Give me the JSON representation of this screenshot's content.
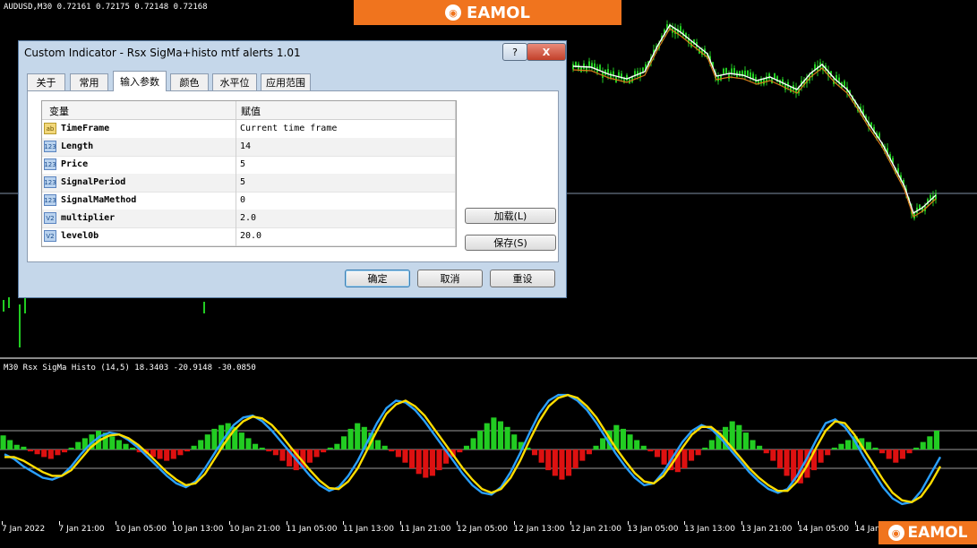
{
  "main_chart": {
    "info": "AUDUSD,M30  0.72161 0.72175 0.72148 0.72168"
  },
  "sub_chart": {
    "info": "M30  Rsx SigMa Histo (14,5) 18.3403 -20.9148 -30.0850"
  },
  "branding": {
    "text": "EAMOL",
    "icon": "eamol-logo-icon"
  },
  "time_axis": [
    "7 Jan 2022",
    "7 Jan 21:00",
    "10 Jan 05:00",
    "10 Jan 13:00",
    "10 Jan 21:00",
    "11 Jan 05:00",
    "11 Jan 13:00",
    "11 Jan 21:00",
    "12 Jan 05:00",
    "12 Jan 13:00",
    "12 Jan 21:00",
    "13 Jan 05:00",
    "13 Jan 13:00",
    "13 Jan 21:00",
    "14 Jan 05:00",
    "14 Jan 13:00"
  ],
  "colors": {
    "up_bar": "#22cc22",
    "down_bar": "#dd1111",
    "signal_line": "#ffdd00",
    "rsx_line": "#2aa0ff",
    "ma_line": "#d97a1a",
    "price_line": "#ffffff",
    "brand": "#f0741e"
  },
  "dialog": {
    "title": "Custom Indicator - Rsx SigMa+histo mtf alerts 1.01",
    "help_label": "?",
    "close_label": "X",
    "tabs": [
      {
        "label": "关于",
        "active": false
      },
      {
        "label": "常用",
        "active": false
      },
      {
        "label": "输入参数",
        "active": true
      },
      {
        "label": "颜色",
        "active": false
      },
      {
        "label": "水平位",
        "active": false
      },
      {
        "label": "应用范围",
        "active": false
      }
    ],
    "grid": {
      "columns": [
        "变量",
        "赋值"
      ],
      "rows": [
        {
          "icon": "ab",
          "name": "TimeFrame",
          "value": "Current time frame"
        },
        {
          "icon": "123",
          "name": "Length",
          "value": "14"
        },
        {
          "icon": "123",
          "name": "Price",
          "value": "5"
        },
        {
          "icon": "123",
          "name": "SignalPeriod",
          "value": "5"
        },
        {
          "icon": "123",
          "name": "SignalMaMethod",
          "value": "0"
        },
        {
          "icon": "V2",
          "name": "multiplier",
          "value": "2.0"
        },
        {
          "icon": "V2",
          "name": "level0b",
          "value": "20.0"
        }
      ]
    },
    "load_label": "加载(L)",
    "save_label": "保存(S)",
    "ok_label": "确定",
    "cancel_label": "取消",
    "reset_label": "重设"
  },
  "chart_data": {
    "type": "bar",
    "title": "Rsx SigMa Histo (14,5)",
    "params": [
      14,
      5
    ],
    "values_shown": [
      18.3403,
      -20.9148,
      -30.085
    ],
    "levels": [
      20,
      0,
      -20
    ],
    "series": [
      {
        "name": "histogram",
        "values": [
          15,
          10,
          5,
          3,
          -2,
          -5,
          -8,
          -10,
          -6,
          -3,
          2,
          8,
          12,
          16,
          20,
          18,
          14,
          10,
          6,
          2,
          -3,
          -5,
          -8,
          -10,
          -12,
          -10,
          -6,
          -2,
          4,
          10,
          16,
          22,
          26,
          28,
          24,
          18,
          12,
          6,
          2,
          -2,
          -6,
          -12,
          -18,
          -22,
          -20,
          -14,
          -8,
          -3,
          2,
          6,
          14,
          22,
          28,
          24,
          18,
          10,
          4,
          -2,
          -8,
          -14,
          -20,
          -26,
          -30,
          -28,
          -22,
          -15,
          -8,
          -3,
          4,
          12,
          20,
          28,
          34,
          30,
          24,
          16,
          8,
          2,
          -6,
          -14,
          -22,
          -28,
          -32,
          -28,
          -20,
          -12,
          -5,
          4,
          12,
          20,
          26,
          22,
          16,
          10,
          4,
          -2,
          -8,
          -16,
          -22,
          -24,
          -20,
          -12,
          -6,
          2,
          10,
          18,
          24,
          30,
          26,
          18,
          10,
          4,
          -4,
          -12,
          -20,
          -28,
          -34,
          -36,
          -30,
          -22,
          -14,
          -6,
          2,
          6,
          10,
          14,
          12,
          8,
          2,
          -4,
          -10,
          -14,
          -10,
          -4,
          2,
          8,
          14,
          20
        ]
      },
      {
        "name": "rsx",
        "values": [
          -5,
          -10,
          -18,
          -24,
          -30,
          -32,
          -28,
          -18,
          -5,
          6,
          14,
          18,
          16,
          10,
          2,
          -8,
          -18,
          -28,
          -36,
          -40,
          -34,
          -20,
          -4,
          12,
          26,
          34,
          36,
          30,
          20,
          8,
          -4,
          -16,
          -28,
          -38,
          -44,
          -40,
          -28,
          -12,
          8,
          28,
          44,
          52,
          50,
          42,
          30,
          16,
          2,
          -12,
          -26,
          -38,
          -46,
          -48,
          -40,
          -24,
          -4,
          18,
          38,
          52,
          58,
          58,
          52,
          42,
          28,
          12,
          -4,
          -18,
          -30,
          -38,
          -36,
          -24,
          -8,
          8,
          20,
          26,
          22,
          12,
          0,
          -12,
          -24,
          -34,
          -42,
          -46,
          -42,
          -28,
          -10,
          10,
          28,
          32,
          24,
          10,
          -8,
          -24,
          -40,
          -52,
          -58,
          -56,
          -44,
          -26,
          -8
        ]
      },
      {
        "name": "signal",
        "values": [
          -8,
          -8,
          -12,
          -18,
          -24,
          -28,
          -28,
          -22,
          -10,
          2,
          10,
          15,
          16,
          12,
          5,
          -4,
          -14,
          -24,
          -32,
          -38,
          -36,
          -26,
          -10,
          6,
          20,
          30,
          35,
          33,
          26,
          15,
          2,
          -10,
          -22,
          -33,
          -41,
          -42,
          -34,
          -20,
          0,
          20,
          38,
          48,
          52,
          46,
          36,
          22,
          8,
          -6,
          -20,
          -32,
          -42,
          -46,
          -42,
          -30,
          -12,
          10,
          30,
          46,
          55,
          58,
          55,
          46,
          34,
          18,
          2,
          -12,
          -25,
          -34,
          -36,
          -28,
          -14,
          2,
          16,
          24,
          24,
          16,
          4,
          -8,
          -20,
          -30,
          -38,
          -44,
          -44,
          -34,
          -18,
          2,
          20,
          30,
          28,
          16,
          0,
          -16,
          -32,
          -46,
          -54,
          -56,
          -50,
          -36,
          -18
        ]
      }
    ]
  }
}
